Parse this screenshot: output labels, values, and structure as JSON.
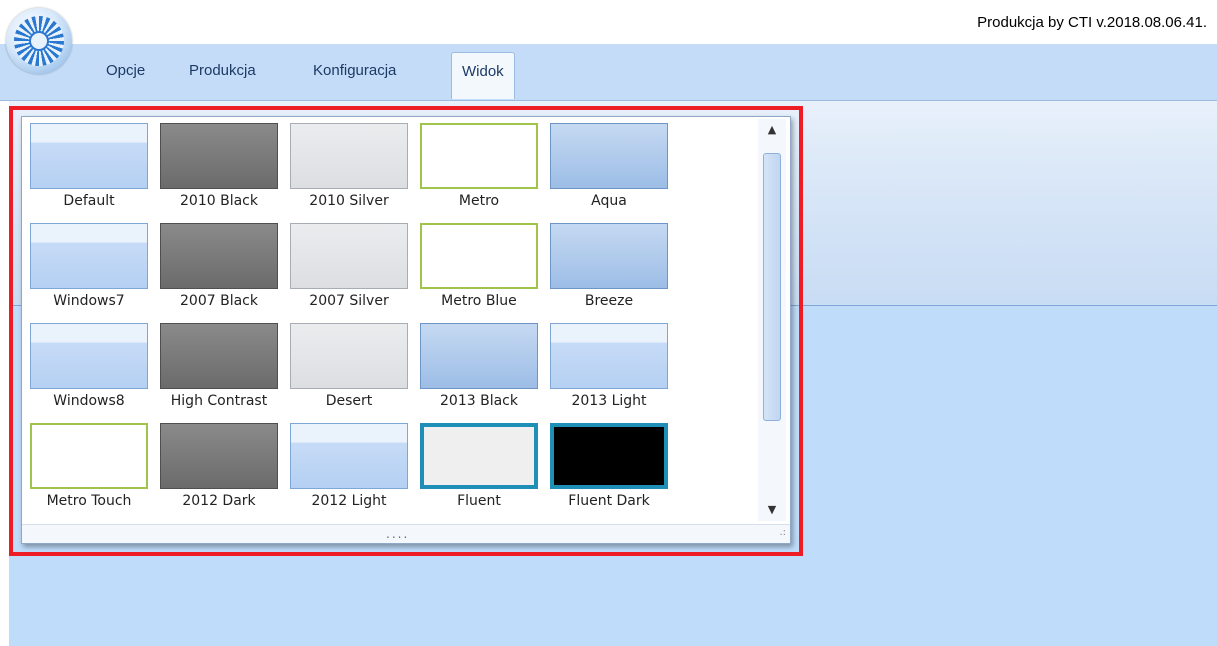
{
  "app": {
    "title": "Produkcja by CTI v.2018.08.06.41."
  },
  "tabs": [
    {
      "label": "Opcje"
    },
    {
      "label": "Produkcja"
    },
    {
      "label": "Konfiguracja"
    },
    {
      "label": "Widok",
      "active": true
    }
  ],
  "gallery": {
    "themes": [
      {
        "label": "Default",
        "swatch": "blue"
      },
      {
        "label": "2010 Black",
        "swatch": "black"
      },
      {
        "label": "2010 Silver",
        "swatch": "silver"
      },
      {
        "label": "Metro",
        "swatch": "metro"
      },
      {
        "label": "Aqua",
        "swatch": "aqua"
      },
      {
        "label": "Windows7",
        "swatch": "blue"
      },
      {
        "label": "2007 Black",
        "swatch": "black"
      },
      {
        "label": "2007 Silver",
        "swatch": "silver"
      },
      {
        "label": "Metro Blue",
        "swatch": "metro"
      },
      {
        "label": "Breeze",
        "swatch": "aqua"
      },
      {
        "label": "Windows8",
        "swatch": "blue"
      },
      {
        "label": "High Contrast",
        "swatch": "black"
      },
      {
        "label": "Desert",
        "swatch": "silver"
      },
      {
        "label": "2013 Black",
        "swatch": "aqua"
      },
      {
        "label": "2013 Light",
        "swatch": "blue"
      },
      {
        "label": "Metro Touch",
        "swatch": "metro"
      },
      {
        "label": "2012 Dark",
        "swatch": "black"
      },
      {
        "label": "2012 Light",
        "swatch": "blue"
      },
      {
        "label": "Fluent",
        "swatch": "fluent"
      },
      {
        "label": "Fluent Dark",
        "swatch": "fluentdark"
      }
    ],
    "grip_dots": "....",
    "scroll_up_glyph": "▲",
    "scroll_down_glyph": "▼"
  },
  "colors": {
    "highlight": "#ee1c24",
    "ribbon": "#c4dcf7",
    "workspace": "#bfdcfb",
    "fluent_accent": "#1f8fb7"
  }
}
